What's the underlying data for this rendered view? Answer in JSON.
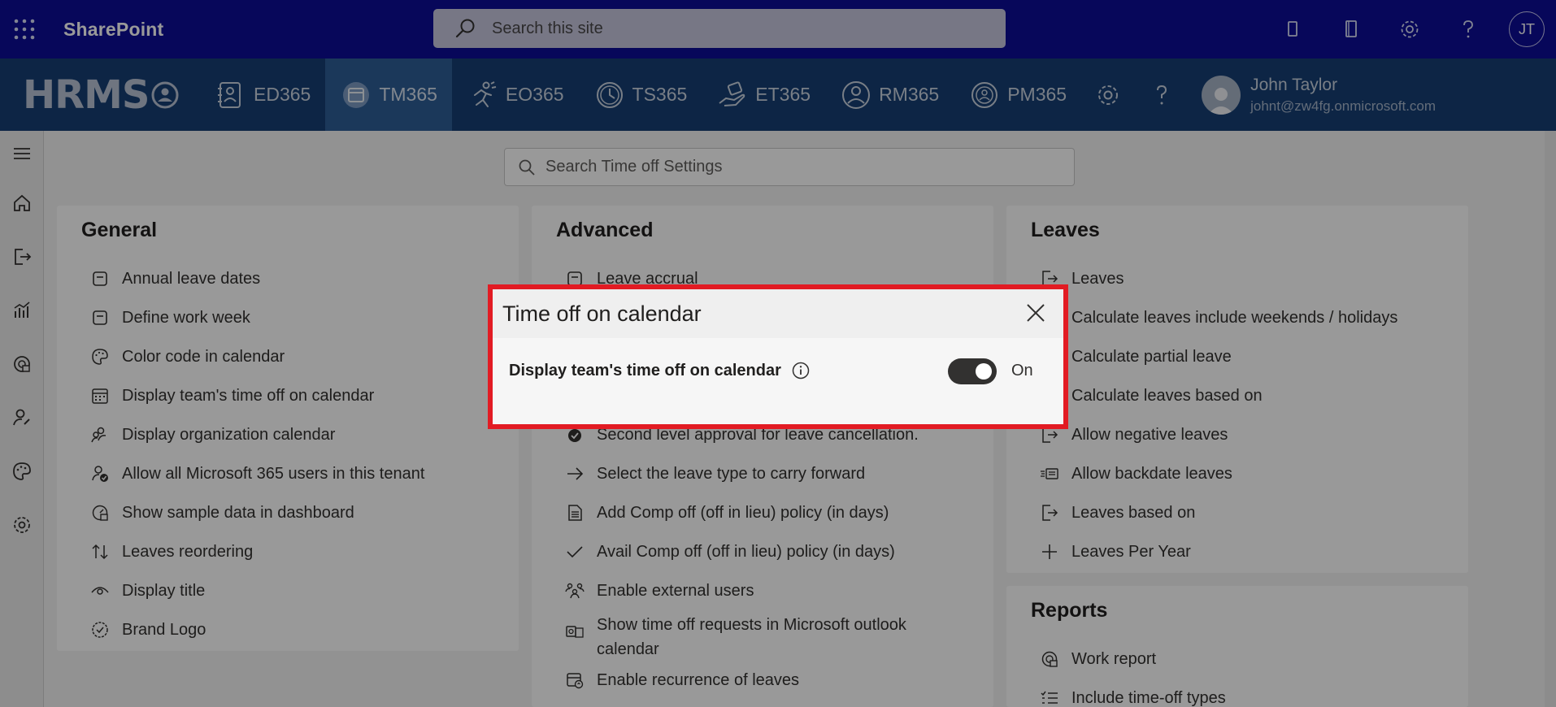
{
  "suitebar": {
    "app_name": "SharePoint",
    "search_placeholder": "Search this site",
    "avatar_initials": "JT"
  },
  "hrms": {
    "logo": "HRMS",
    "tabs": [
      {
        "label": "ED365",
        "icon": "employee-directory-icon"
      },
      {
        "label": "TM365",
        "icon": "time-off-calendar-icon",
        "active": true
      },
      {
        "label": "EO365",
        "icon": "onboarding-runner-icon"
      },
      {
        "label": "TS365",
        "icon": "timesheet-clock-icon"
      },
      {
        "label": "ET365",
        "icon": "expense-hand-icon"
      },
      {
        "label": "RM365",
        "icon": "resource-person-icon"
      },
      {
        "label": "PM365",
        "icon": "performance-badge-icon"
      }
    ],
    "user": {
      "name": "John Taylor",
      "email": "johnt@zw4fg.onmicrosoft.com"
    }
  },
  "settings_search_placeholder": "Search Time off Settings",
  "panels": {
    "general": {
      "title": "General",
      "items": [
        {
          "label": "Annual leave dates",
          "icon": "calendar-icon"
        },
        {
          "label": "Define work week",
          "icon": "calendar-icon"
        },
        {
          "label": "Color code in calendar",
          "icon": "palette-icon"
        },
        {
          "label": "Display team's time off on calendar",
          "icon": "calendar-grid-icon"
        },
        {
          "label": "Display organization calendar",
          "icon": "people-icon"
        },
        {
          "label": "Allow all Microsoft 365 users in this tenant",
          "icon": "person-check-icon"
        },
        {
          "label": "Show sample data in dashboard",
          "icon": "gauge-icon"
        },
        {
          "label": "Leaves reordering",
          "icon": "sort-arrows-icon"
        },
        {
          "label": "Display title",
          "icon": "eye-icon"
        },
        {
          "label": "Brand Logo",
          "icon": "badge-icon"
        }
      ]
    },
    "advanced": {
      "title": "Advanced",
      "items": [
        {
          "label": "Leave accrual",
          "icon": "calendar-icon"
        },
        {
          "label": "Second level approval for leave cancellation.",
          "icon": "check-circle-icon"
        },
        {
          "label": "Select the leave type to carry forward",
          "icon": "arrow-right-icon"
        },
        {
          "label": "Add Comp off (off in lieu) policy (in days)",
          "icon": "document-icon"
        },
        {
          "label": "Avail Comp off (off in lieu) policy (in days)",
          "icon": "checkmark-icon"
        },
        {
          "label": "Enable external users",
          "icon": "people-group-icon"
        },
        {
          "label": "Show time off requests in Microsoft outlook calendar",
          "icon": "outlook-icon"
        },
        {
          "label": "Enable recurrence of leaves",
          "icon": "calendar-repeat-icon"
        }
      ]
    },
    "leaves": {
      "title": "Leaves",
      "items": [
        {
          "label": "Leaves",
          "icon": "leave-exit-icon"
        },
        {
          "label": "Calculate leaves include weekends / holidays",
          "icon": "leave-exit-icon"
        },
        {
          "label": "Calculate partial leave",
          "icon": "leave-exit-icon"
        },
        {
          "label": "Calculate leaves based on",
          "icon": "leave-exit-icon"
        },
        {
          "label": "Allow negative leaves",
          "icon": "leave-exit-icon"
        },
        {
          "label": "Allow backdate leaves",
          "icon": "backdate-icon"
        },
        {
          "label": "Leaves based on",
          "icon": "leave-exit-icon"
        },
        {
          "label": "Leaves Per Year",
          "icon": "plus-icon"
        }
      ]
    },
    "reports": {
      "title": "Reports",
      "items": [
        {
          "label": "Work report",
          "icon": "report-gauge-icon"
        },
        {
          "label": "Include time-off types",
          "icon": "list-check-icon"
        }
      ]
    }
  },
  "dialog": {
    "title": "Time off on calendar",
    "setting_label": "Display team's time off on calendar",
    "toggle_state": "On",
    "toggle_on": true
  },
  "colors": {
    "suitebar_bg": "#0c0c96",
    "hrms_bg": "#163f74",
    "highlight_border": "#e21b23"
  }
}
